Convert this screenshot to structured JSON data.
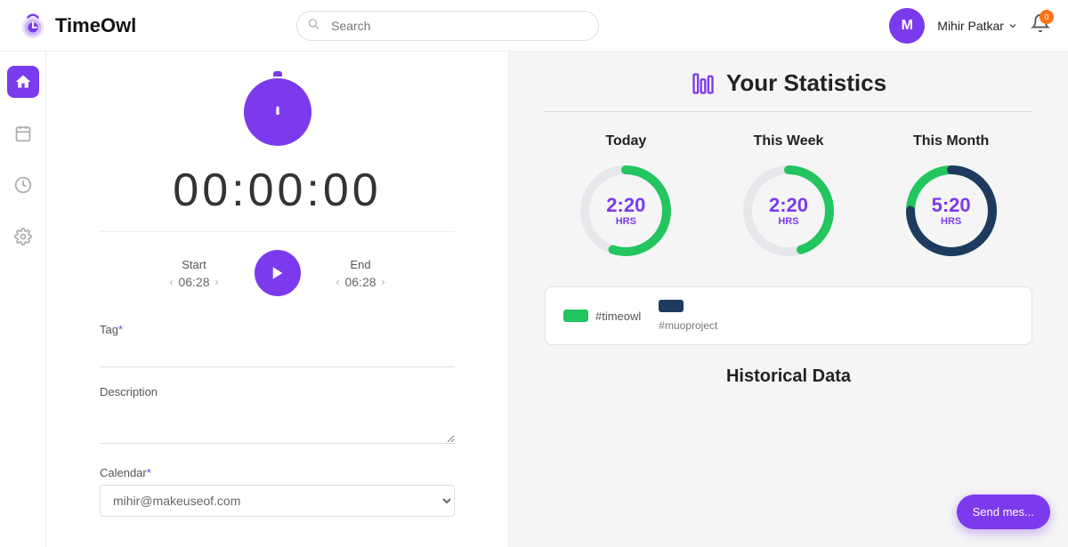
{
  "header": {
    "logo_text": "TimeOwl",
    "search_placeholder": "Search",
    "user_initial": "M",
    "user_name": "Mihir Patkar",
    "notification_count": "0"
  },
  "sidebar": {
    "items": [
      {
        "icon": "home",
        "label": "Home",
        "active": true
      },
      {
        "icon": "calendar",
        "label": "Calendar",
        "active": false
      },
      {
        "icon": "clock",
        "label": "History",
        "active": false
      },
      {
        "icon": "settings",
        "label": "Settings",
        "active": false
      }
    ]
  },
  "timer": {
    "display": "00:00:00",
    "start_label": "Start",
    "start_time": "06:28",
    "end_label": "End",
    "end_time": "06:28",
    "tag_label": "Tag",
    "tag_required": "*",
    "description_label": "Description",
    "calendar_label": "Calendar",
    "calendar_required": "*",
    "calendar_value": "mihir@makeuseof.com"
  },
  "stats": {
    "title": "Your Statistics",
    "periods": [
      {
        "label": "Today",
        "time": "2:20",
        "unit": "HRS",
        "progress": 0.55,
        "color": "#22c55e",
        "track": "#e5e7eb"
      },
      {
        "label": "This Week",
        "time": "2:20",
        "unit": "HRS",
        "progress": 0.45,
        "color": "#22c55e",
        "track": "#e5e7eb"
      },
      {
        "label": "This Month",
        "time": "5:20",
        "unit": "HRS",
        "progress": 0.75,
        "color": "#1e3a5f",
        "track": "#22c55e"
      }
    ],
    "legend": [
      {
        "tag": "#timeowl",
        "color": "#22c55e"
      },
      {
        "tag": "#muoproject",
        "color": "#1e3a5f"
      }
    ],
    "historical_label": "Historical Data"
  },
  "chat": {
    "button_label": "Send mes..."
  }
}
